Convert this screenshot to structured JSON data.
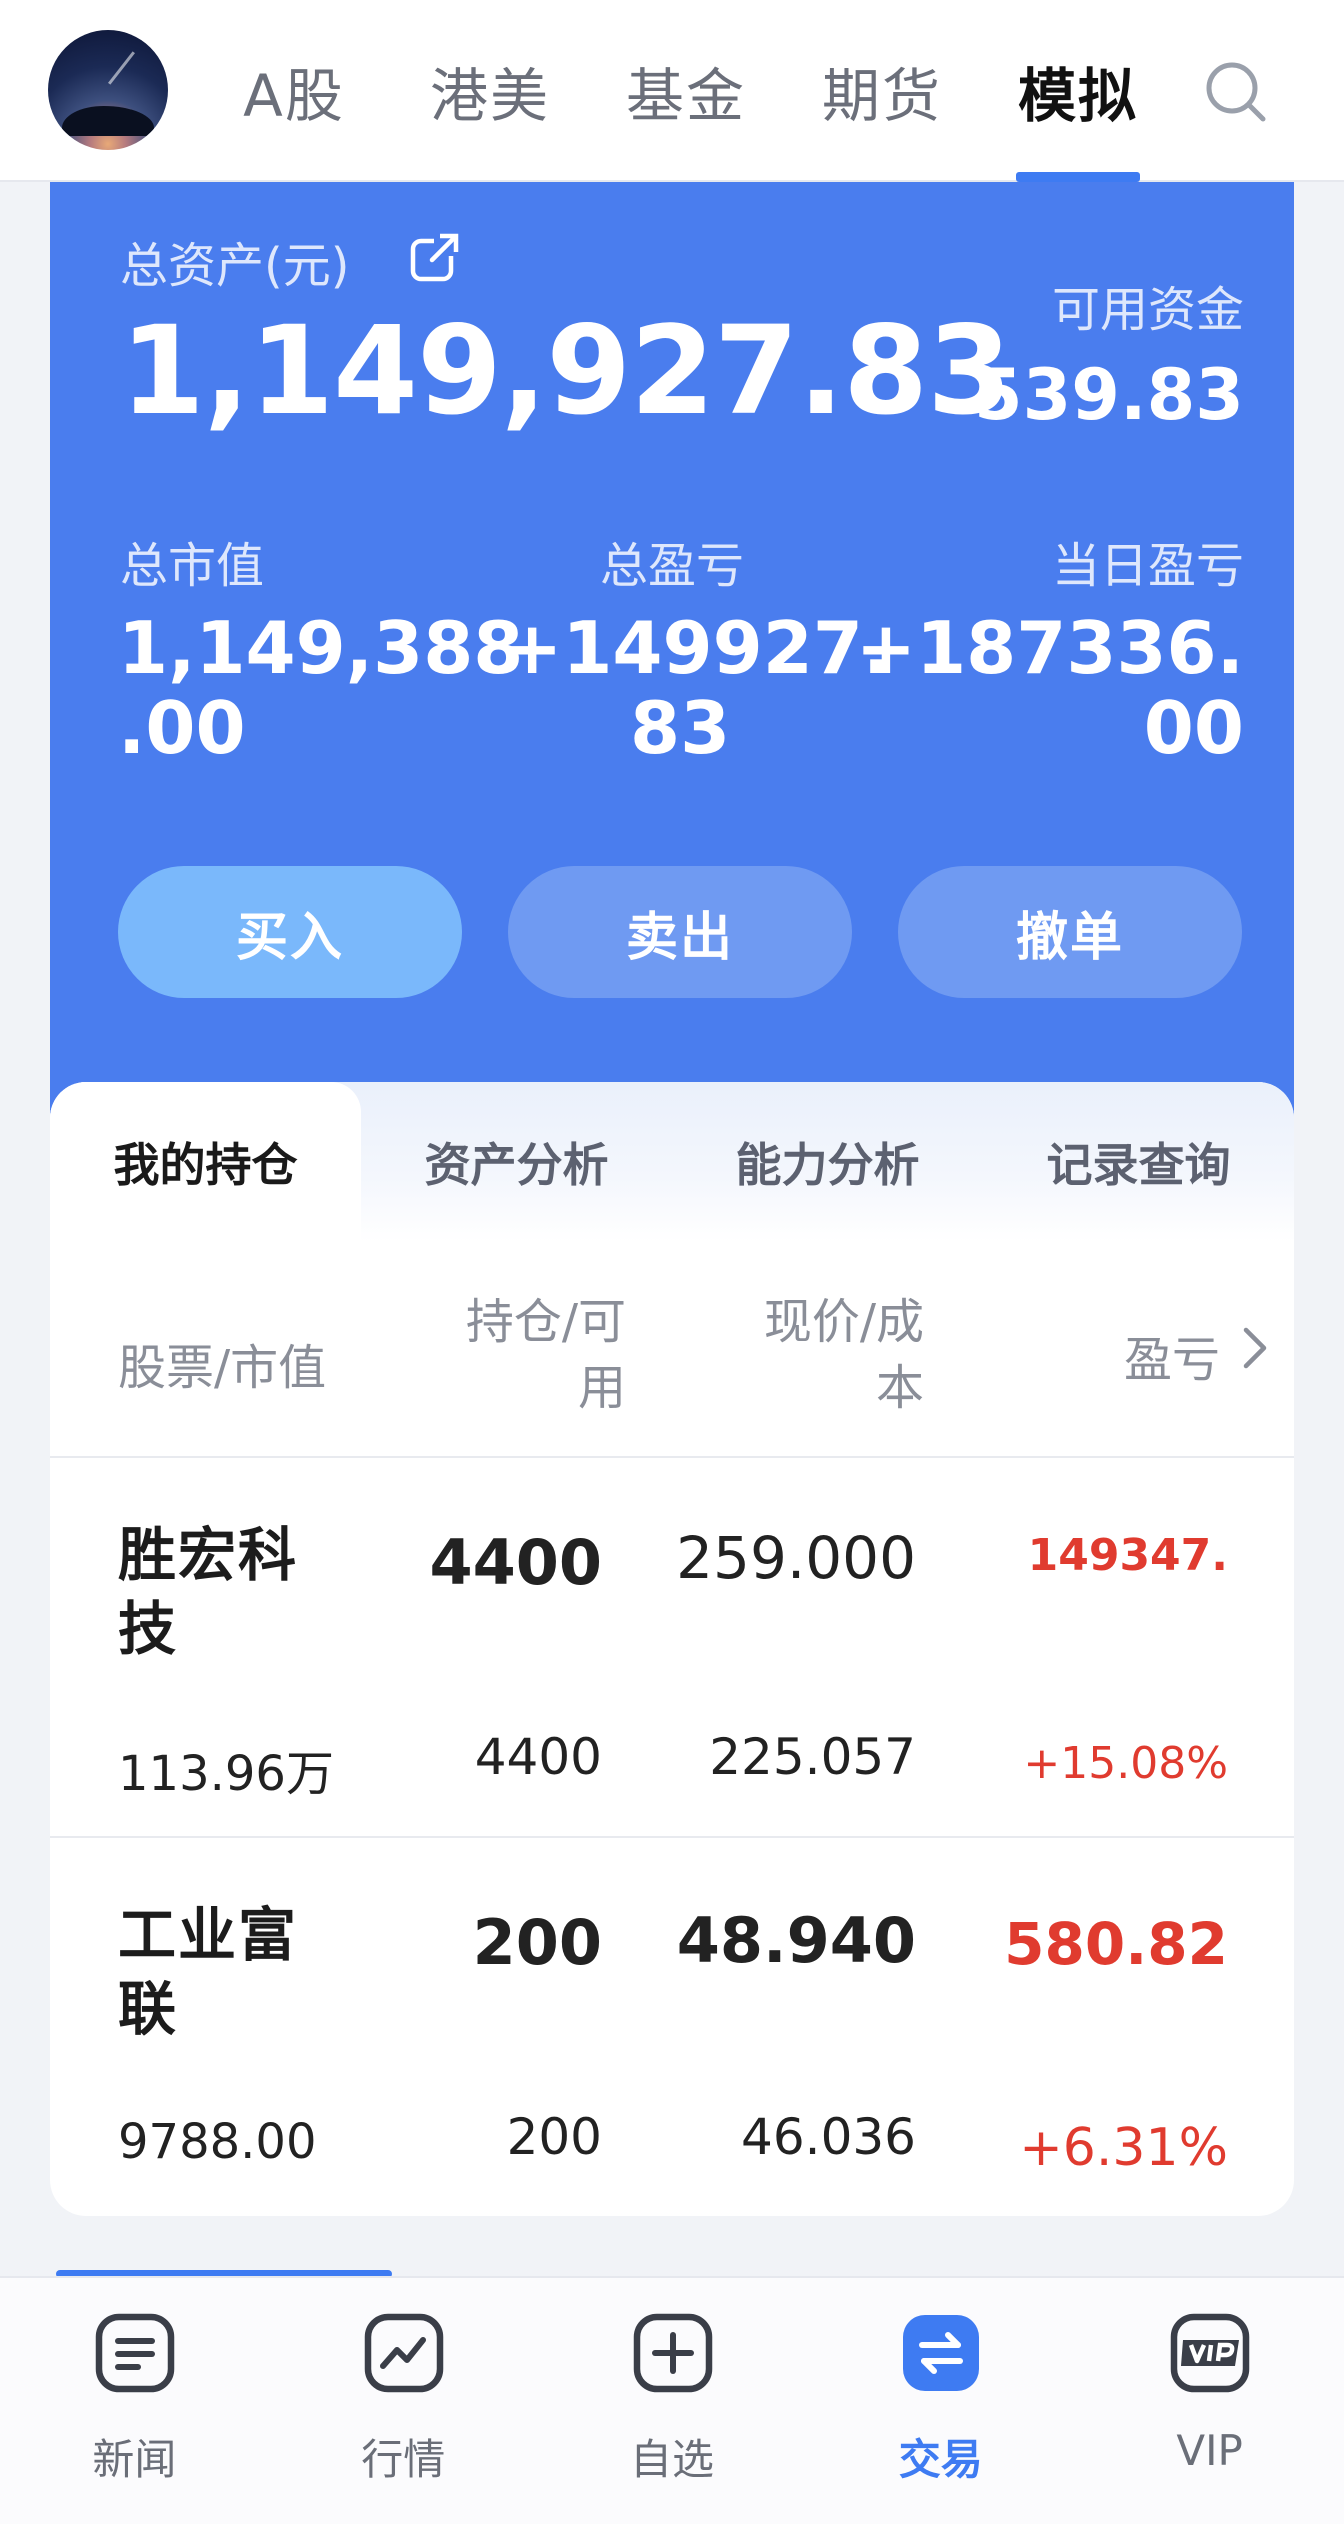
{
  "topnav": {
    "tabs": [
      {
        "label": "A股"
      },
      {
        "label": "港美"
      },
      {
        "label": "基金"
      },
      {
        "label": "期货"
      },
      {
        "label": "模拟"
      }
    ],
    "active_tab": "模拟"
  },
  "account": {
    "total_assets_label": "总资产(元)",
    "total_assets": "1,149,927.83",
    "available_funds_label": "可用资金",
    "available_funds": "539.83",
    "market_value_label": "总市值",
    "market_value_line1": "1,149,388",
    "market_value_line2": ".00",
    "total_pnl_label": "总盈亏",
    "total_pnl_line1": "+149927.",
    "total_pnl_line2": "83",
    "daily_pnl_label": "当日盈亏",
    "daily_pnl_line1": "+187336.",
    "daily_pnl_line2": "00",
    "buy_label": "买入",
    "sell_label": "卖出",
    "cancel_label": "撤单"
  },
  "positions_tabs": [
    {
      "label": "我的持仓"
    },
    {
      "label": "资产分析"
    },
    {
      "label": "能力分析"
    },
    {
      "label": "记录查询"
    }
  ],
  "columns": {
    "stock_mv": "股票/市值",
    "qty_line1": "持仓/可",
    "qty_line2": "用",
    "price_line1": "现价/成",
    "price_line2": "本",
    "pnl": "盈亏"
  },
  "positions": [
    {
      "name": "胜宏科技",
      "market_value": "113.96万",
      "holding": "4400",
      "available": "4400",
      "price": "259.000",
      "cost": "225.057",
      "pnl": "149347.",
      "pnl_pct": "+15.08%"
    },
    {
      "name": "工业富联",
      "market_value": "9788.00",
      "holding": "200",
      "available": "200",
      "price": "48.940",
      "cost": "46.036",
      "pnl": "580.82",
      "pnl_pct": "+6.31%"
    }
  ],
  "bottom_nav": [
    {
      "label": "新闻",
      "icon": "news-icon"
    },
    {
      "label": "行情",
      "icon": "chart-icon"
    },
    {
      "label": "自选",
      "icon": "add-watchlist-icon"
    },
    {
      "label": "交易",
      "icon": "trade-exchange-icon"
    },
    {
      "label": "VIP",
      "icon": "vip-icon"
    }
  ],
  "colors": {
    "accent": "#3e7bf2",
    "card_blue": "#4a7dee",
    "gain_red": "#e03b2f"
  }
}
